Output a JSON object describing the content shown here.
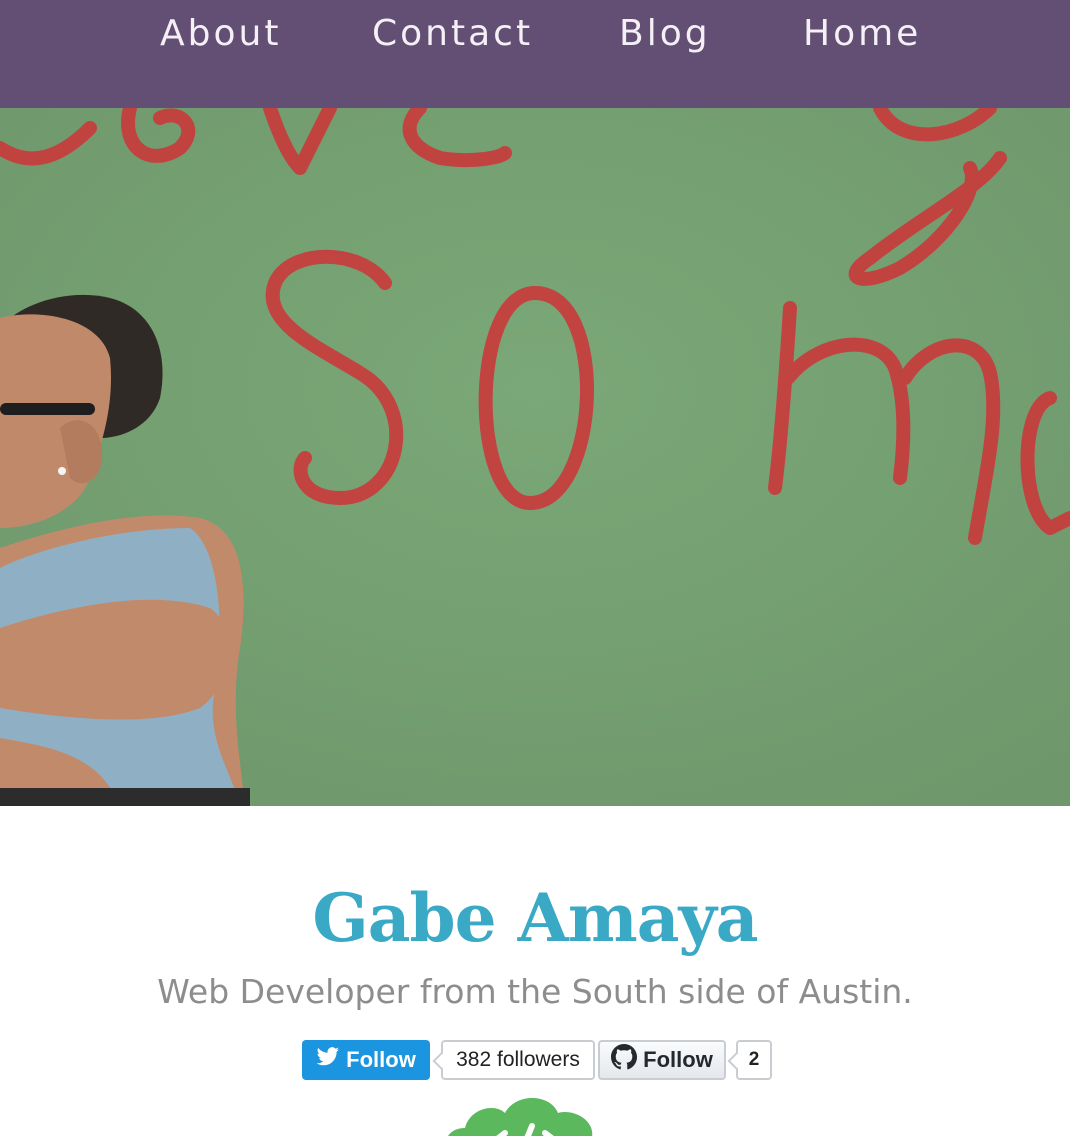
{
  "nav": {
    "items": [
      {
        "label": "About"
      },
      {
        "label": "Contact"
      },
      {
        "label": "Blog"
      },
      {
        "label": "Home"
      }
    ],
    "background": "#634e74"
  },
  "hero": {
    "graffiti_text": "So m",
    "background": "#769f72",
    "graffiti_color": "#c83c3c"
  },
  "profile": {
    "name": "Gabe Amaya",
    "tagline": "Web Developer from the South side of Austin.",
    "name_color": "#3aa9c5"
  },
  "social": {
    "twitter": {
      "label": "Follow",
      "count_text": "382 followers",
      "icon": "twitter-bird-icon",
      "color": "#1b95e0"
    },
    "github": {
      "label": "Follow",
      "count_text": "2",
      "icon": "github-octocat-icon"
    }
  },
  "logo": {
    "icon": "code-cloud-icon",
    "color": "#5cb85c"
  }
}
